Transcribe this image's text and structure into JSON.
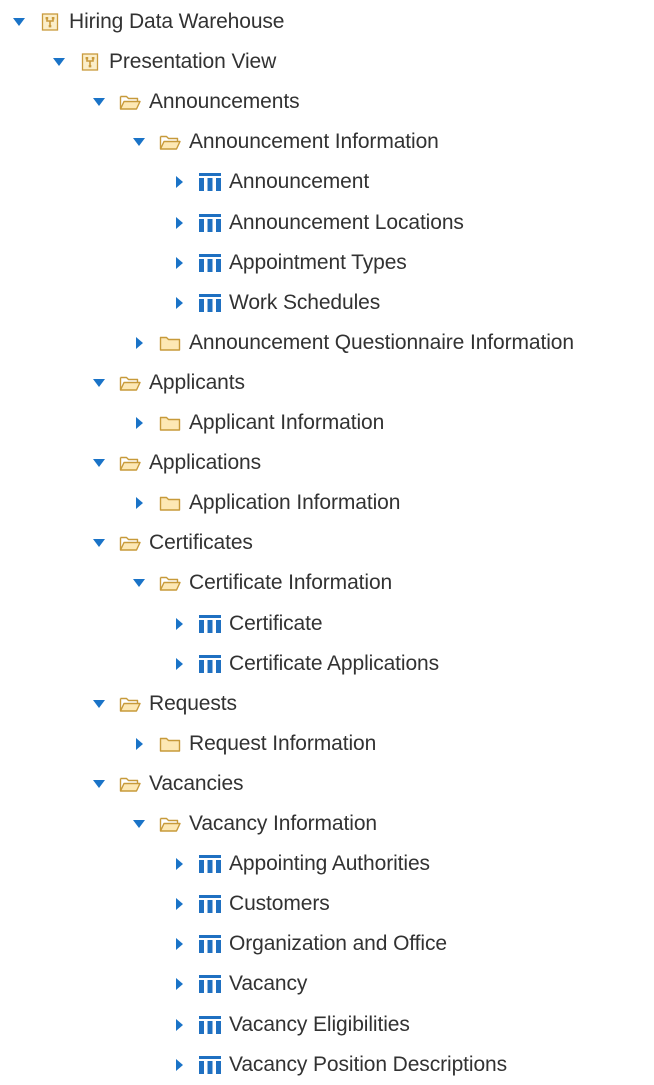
{
  "tree": [
    {
      "label": "Hiring Data Warehouse",
      "depth": 0,
      "icon": "model-icon",
      "expanded": true
    },
    {
      "label": "Presentation View",
      "depth": 1,
      "icon": "model-icon",
      "expanded": true
    },
    {
      "label": "Announcements",
      "depth": 2,
      "icon": "folder-open-icon",
      "expanded": true
    },
    {
      "label": "Announcement Information",
      "depth": 3,
      "icon": "folder-open-icon",
      "expanded": true
    },
    {
      "label": "Announcement",
      "depth": 4,
      "icon": "table-icon",
      "expanded": false
    },
    {
      "label": "Announcement Locations",
      "depth": 4,
      "icon": "table-icon",
      "expanded": false
    },
    {
      "label": "Appointment Types",
      "depth": 4,
      "icon": "table-icon",
      "expanded": false
    },
    {
      "label": "Work Schedules",
      "depth": 4,
      "icon": "table-icon",
      "expanded": false
    },
    {
      "label": "Announcement Questionnaire Information",
      "depth": 3,
      "icon": "folder-icon",
      "expanded": false
    },
    {
      "label": "Applicants",
      "depth": 2,
      "icon": "folder-open-icon",
      "expanded": true
    },
    {
      "label": "Applicant Information",
      "depth": 3,
      "icon": "folder-icon",
      "expanded": false
    },
    {
      "label": "Applications",
      "depth": 2,
      "icon": "folder-open-icon",
      "expanded": true
    },
    {
      "label": "Application Information",
      "depth": 3,
      "icon": "folder-icon",
      "expanded": false
    },
    {
      "label": "Certificates",
      "depth": 2,
      "icon": "folder-open-icon",
      "expanded": true
    },
    {
      "label": "Certificate Information",
      "depth": 3,
      "icon": "folder-open-icon",
      "expanded": true
    },
    {
      "label": "Certificate",
      "depth": 4,
      "icon": "table-icon",
      "expanded": false
    },
    {
      "label": "Certificate Applications",
      "depth": 4,
      "icon": "table-icon",
      "expanded": false
    },
    {
      "label": "Requests",
      "depth": 2,
      "icon": "folder-open-icon",
      "expanded": true
    },
    {
      "label": "Request Information",
      "depth": 3,
      "icon": "folder-icon",
      "expanded": false
    },
    {
      "label": "Vacancies",
      "depth": 2,
      "icon": "folder-open-icon",
      "expanded": true
    },
    {
      "label": "Vacancy Information",
      "depth": 3,
      "icon": "folder-open-icon",
      "expanded": true
    },
    {
      "label": "Appointing Authorities",
      "depth": 4,
      "icon": "table-icon",
      "expanded": false
    },
    {
      "label": "Customers",
      "depth": 4,
      "icon": "table-icon",
      "expanded": false
    },
    {
      "label": "Organization and Office",
      "depth": 4,
      "icon": "table-icon",
      "expanded": false
    },
    {
      "label": "Vacancy",
      "depth": 4,
      "icon": "table-icon",
      "expanded": false
    },
    {
      "label": "Vacancy Eligibilities",
      "depth": 4,
      "icon": "table-icon",
      "expanded": false
    },
    {
      "label": "Vacancy Position Descriptions",
      "depth": 4,
      "icon": "table-icon",
      "expanded": false
    }
  ],
  "colors": {
    "twisty": "#1a73c7",
    "folder_fill": "#fde8b4",
    "folder_stroke": "#c79a3a",
    "table_blue": "#1f70c1",
    "model_fill": "#fbeec9",
    "model_stroke": "#c99a3c"
  }
}
